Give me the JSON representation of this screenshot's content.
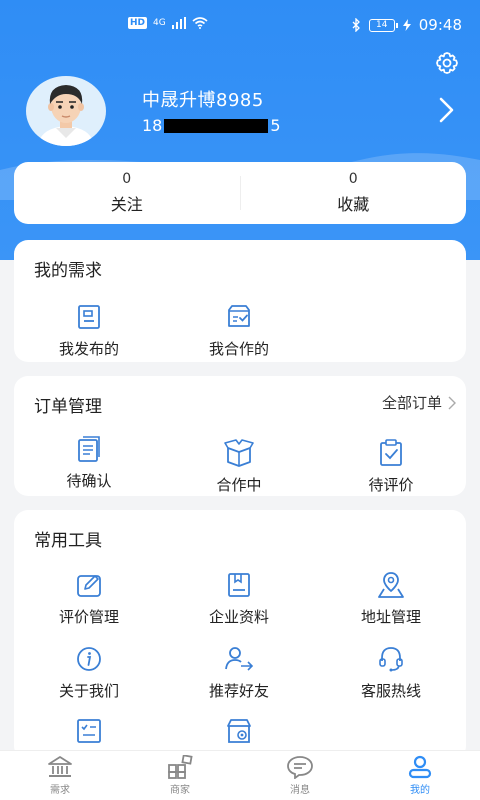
{
  "status_bar": {
    "network_badge": "HD",
    "signal": "4G",
    "battery": "14",
    "time": "09:48"
  },
  "profile": {
    "username": "中晟升博8985",
    "phone_prefix": "18",
    "phone_suffix": "5"
  },
  "stats": [
    {
      "value": "0",
      "label": "关注"
    },
    {
      "value": "0",
      "label": "收藏"
    }
  ],
  "demand": {
    "title": "我的需求",
    "items": [
      {
        "label": "我发布的",
        "icon": "document-icon"
      },
      {
        "label": "我合作的",
        "icon": "inbox-check-icon"
      }
    ]
  },
  "orders": {
    "title": "订单管理",
    "all_link": "全部订单",
    "items": [
      {
        "label": "待确认",
        "icon": "clipboard-list-icon"
      },
      {
        "label": "合作中",
        "icon": "box-open-icon"
      },
      {
        "label": "待评价",
        "icon": "clipboard-check-icon"
      }
    ]
  },
  "tools": {
    "title": "常用工具",
    "items": [
      {
        "label": "评价管理",
        "icon": "edit-icon"
      },
      {
        "label": "企业资料",
        "icon": "company-file-icon"
      },
      {
        "label": "地址管理",
        "icon": "location-icon"
      },
      {
        "label": "关于我们",
        "icon": "info-icon"
      },
      {
        "label": "推荐好友",
        "icon": "user-share-icon"
      },
      {
        "label": "客服热线",
        "icon": "headset-icon"
      }
    ]
  },
  "tabbar": {
    "items": [
      {
        "label": "需求",
        "icon": "bank-icon",
        "active": false
      },
      {
        "label": "商家",
        "icon": "grid-icon",
        "active": false
      },
      {
        "label": "消息",
        "icon": "chat-icon",
        "active": false
      },
      {
        "label": "我的",
        "icon": "user-icon",
        "active": true
      }
    ]
  },
  "colors": {
    "primary": "#2f8df5",
    "background": "#f3f4f6",
    "icon_blue": "#3a7fd5"
  }
}
